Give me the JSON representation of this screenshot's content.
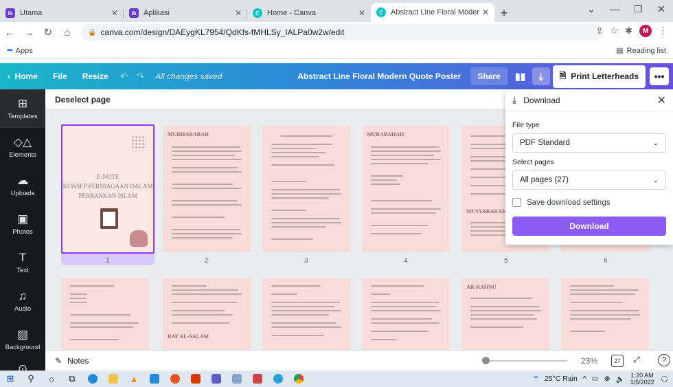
{
  "browser": {
    "tabs": [
      {
        "title": "Utama",
        "active": false,
        "color": "#6c3bd1"
      },
      {
        "title": "Aplikasi",
        "active": false,
        "color": "#6c3bd1"
      },
      {
        "title": "Home - Canva",
        "active": false,
        "color": "#00c4cc"
      },
      {
        "title": "Abstract Line Floral Modern Quo",
        "active": true,
        "color": "#00c4cc"
      }
    ],
    "url": "canva.com/design/DAEygKL7954/QdKfs-fMHLSy_IALPa0w2w/edit",
    "avatar_letter": "M",
    "bookmarks_apps": "Apps",
    "reading_list": "Reading list"
  },
  "toolbar": {
    "home": "Home",
    "file": "File",
    "resize": "Resize",
    "saved": "All changes saved",
    "doc_title": "Abstract Line Floral Modern Quote Poster",
    "share": "Share",
    "print": "Print Letterheads"
  },
  "sidebar": [
    {
      "label": "Templates",
      "icon": "templates-icon"
    },
    {
      "label": "Elements",
      "icon": "elements-icon"
    },
    {
      "label": "Uploads",
      "icon": "uploads-icon"
    },
    {
      "label": "Photos",
      "icon": "photos-icon"
    },
    {
      "label": "Text",
      "icon": "text-icon"
    },
    {
      "label": "Audio",
      "icon": "audio-icon"
    },
    {
      "label": "Background",
      "icon": "background-icon"
    },
    {
      "label": "Logos",
      "icon": "logos-icon"
    }
  ],
  "editor": {
    "deselect": "Deselect page",
    "cover": {
      "line1": "E-NOTE",
      "line2": "KONSEP PERNIAGAAN DALAM",
      "line3": "PERBANKAN ISLAM"
    },
    "page_titles": [
      "MUDHARABAH",
      "",
      "MURABAHAH",
      "",
      "",
      "",
      "",
      "",
      "AR-RAHNU",
      ""
    ],
    "page_numbers": [
      "1",
      "2",
      "3",
      "4",
      "5",
      "6"
    ],
    "page5_subtitle": "MUSYARAKAH",
    "row2_page2_subtitle": "BAY AL-SALAM"
  },
  "download": {
    "title": "Download",
    "file_type_label": "File type",
    "file_type_value": "PDF Standard",
    "select_pages_label": "Select pages",
    "select_pages_value": "All pages (27)",
    "save_settings": "Save download settings",
    "button": "Download"
  },
  "bottom": {
    "notes": "Notes",
    "zoom": "23%",
    "zoom_fraction": 0.23,
    "page_count": "27",
    "help": "?"
  },
  "taskbar": {
    "weather": "25°C Rain",
    "time": "1:20 AM",
    "date": "1/5/2022"
  }
}
